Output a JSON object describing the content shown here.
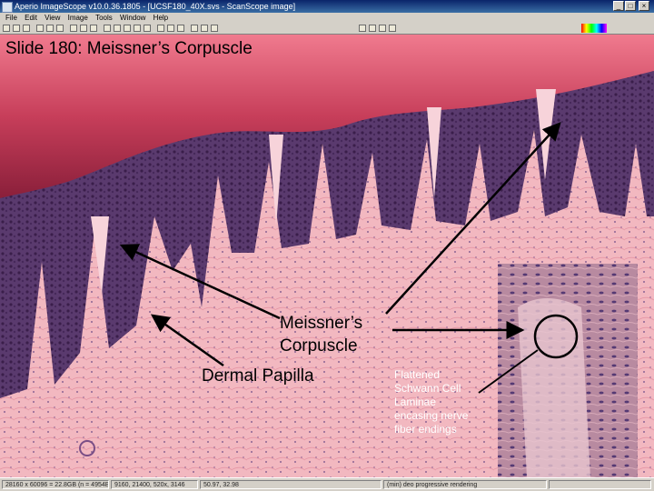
{
  "window": {
    "title": "Aperio ImageScope v10.0.36.1805 - [UCSF180_40X.svs - ScanScope image]",
    "buttons": [
      "_",
      "□",
      "×"
    ]
  },
  "menu": {
    "items": [
      "File",
      "Edit",
      "View",
      "Image",
      "Tools",
      "Window",
      "Help"
    ]
  },
  "slide": {
    "title": "Slide 180: Meissner’s Corpuscle"
  },
  "labels": {
    "meissner_line1": "Meissner’s",
    "meissner_line2": "Corpuscle",
    "dermal_papilla": "Dermal Papilla",
    "flattened": [
      "Flattened",
      "Schwann Cell",
      "Laminae",
      "encasing nerve",
      "fiber endings"
    ]
  },
  "status": {
    "fields": [
      "28160 x 60096 = 22.8GB (n = 4954B",
      "9160, 21400, 520x, 3146",
      "50.97, 32.98",
      "(min) deo progressive rendering"
    ]
  },
  "colors": {
    "epidermis_top": "#e8607a",
    "epidermis_dark": "#4a2a5a",
    "dermis": "#f2b8c0",
    "titlebar": "#0a246a",
    "chrome": "#d4d0c8"
  }
}
